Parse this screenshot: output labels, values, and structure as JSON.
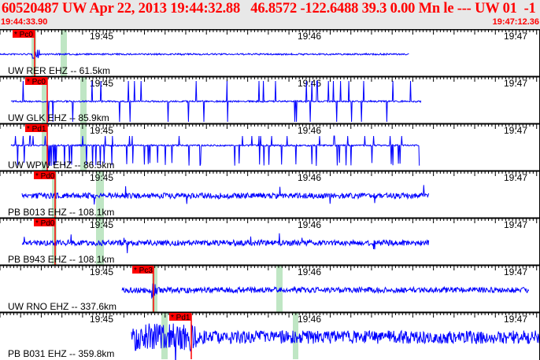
{
  "header": {
    "title": "60520487 UW Apr 22, 2013 19:44:32.88   46.8572 -122.6488 39.3 0.00 Mn le --- UW 01  -1",
    "start_time": "19:44:33.90",
    "end_time": "19:47:12.36"
  },
  "colors": {
    "trace": "#0000ff",
    "pick": "#ff0000",
    "window": "#bfe6c4",
    "header_text": "#ff0000"
  },
  "time_labels": [
    "19:45",
    "19:46",
    "19:47"
  ],
  "channels": [
    {
      "label": "UW RER EHZ -- 61.5km",
      "pick": "* Pc0"
    },
    {
      "label": "UW GLK EHZ -- 85.9km",
      "pick": "* Pc0"
    },
    {
      "label": "UW WPW EHZ -- 86.5km",
      "pick": "* Pd1"
    },
    {
      "label": "PB B013 EHZ -- 108.1km",
      "pick": "* Pd0"
    },
    {
      "label": "PB B943 EHZ -- 108.1km",
      "pick": "* Pd0"
    },
    {
      "label": "UW RNO EHZ -- 337.6km",
      "pick": "* Pc3"
    },
    {
      "label": "PB B031 EHZ -- 359.8km",
      "pick": "* Pd1"
    }
  ]
}
